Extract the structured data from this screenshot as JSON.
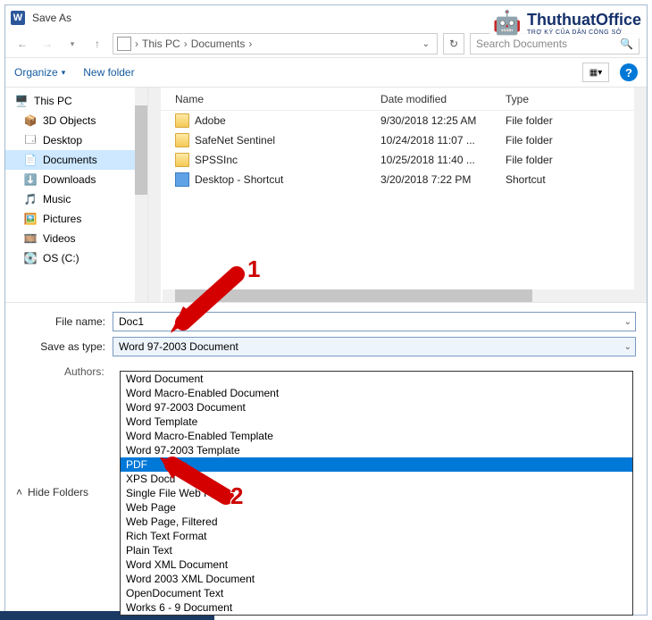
{
  "window": {
    "title": "Save As"
  },
  "nav": {
    "crumb1": "This PC",
    "crumb2": "Documents",
    "search_placeholder": "Search Documents"
  },
  "toolbar": {
    "organize": "Organize",
    "newfolder": "New folder"
  },
  "tree": {
    "thispc": "This PC",
    "obj3d": "3D Objects",
    "desktop": "Desktop",
    "documents": "Documents",
    "downloads": "Downloads",
    "music": "Music",
    "pictures": "Pictures",
    "videos": "Videos",
    "osc": "OS (C:)"
  },
  "columns": {
    "name": "Name",
    "date": "Date modified",
    "type": "Type"
  },
  "rows": [
    {
      "name": "Adobe",
      "date": "9/30/2018 12:25 AM",
      "type": "File folder",
      "icon": "folder"
    },
    {
      "name": "SafeNet Sentinel",
      "date": "10/24/2018 11:07 ...",
      "type": "File folder",
      "icon": "folder"
    },
    {
      "name": "SPSSInc",
      "date": "10/25/2018 11:40 ...",
      "type": "File folder",
      "icon": "folder"
    },
    {
      "name": "Desktop - Shortcut",
      "date": "3/20/2018 7:22 PM",
      "type": "Shortcut",
      "icon": "shortcut"
    }
  ],
  "fields": {
    "filename_label": "File name:",
    "filename_value": "Doc1",
    "type_label": "Save as type:",
    "type_value": "Word 97-2003 Document",
    "authors_label": "Authors:"
  },
  "footer": {
    "hide": "Hide Folders"
  },
  "type_options": [
    "Word Document",
    "Word Macro-Enabled Document",
    "Word 97-2003 Document",
    "Word Template",
    "Word Macro-Enabled Template",
    "Word 97-2003 Template",
    "PDF",
    "XPS Docu",
    "Single File Web Page",
    "Web Page",
    "Web Page, Filtered",
    "Rich Text Format",
    "Plain Text",
    "Word XML Document",
    "Word 2003 XML Document",
    "OpenDocument Text",
    "Works 6 - 9 Document"
  ],
  "selected_type_index": 6,
  "annotations": {
    "one": "1",
    "two": "2"
  },
  "watermark": {
    "brand": "ThuthuatOffice",
    "tag": "TRỢ KÝ CỦA DÂN CÔNG SỞ"
  }
}
